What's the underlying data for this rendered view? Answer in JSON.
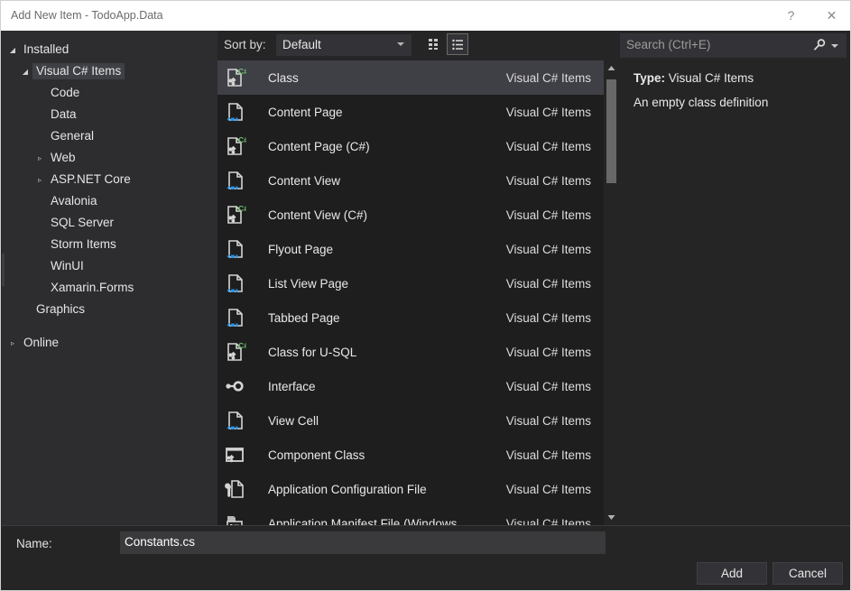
{
  "window": {
    "title": "Add New Item - TodoApp.Data",
    "help_label": "?",
    "close_label": "✕"
  },
  "sidebar": {
    "nodes": [
      {
        "label": "Installed",
        "level": 0,
        "twisty": "expanded",
        "selected": false
      },
      {
        "label": "Visual C# Items",
        "level": 1,
        "twisty": "expanded",
        "selected": true
      },
      {
        "label": "Code",
        "level": 2,
        "twisty": "none",
        "selected": false
      },
      {
        "label": "Data",
        "level": 2,
        "twisty": "none",
        "selected": false
      },
      {
        "label": "General",
        "level": 2,
        "twisty": "none",
        "selected": false
      },
      {
        "label": "Web",
        "level": 2,
        "twisty": "collapsed",
        "selected": false
      },
      {
        "label": "ASP.NET Core",
        "level": 2,
        "twisty": "collapsed",
        "selected": false
      },
      {
        "label": "Avalonia",
        "level": 2,
        "twisty": "none",
        "selected": false
      },
      {
        "label": "SQL Server",
        "level": 2,
        "twisty": "none",
        "selected": false
      },
      {
        "label": "Storm Items",
        "level": 2,
        "twisty": "none",
        "selected": false
      },
      {
        "label": "WinUI",
        "level": 2,
        "twisty": "none",
        "selected": false
      },
      {
        "label": "Xamarin.Forms",
        "level": 2,
        "twisty": "none",
        "selected": false
      },
      {
        "label": "Graphics",
        "level": 1,
        "twisty": "none",
        "selected": false
      },
      {
        "label": "Online",
        "level": 0,
        "twisty": "collapsed",
        "selected": false
      }
    ]
  },
  "toolbar": {
    "sort_by_label": "Sort by:",
    "sort_by_value": "Default",
    "tiles_view_icon": "tiles-view-icon",
    "list_view_icon": "list-view-icon"
  },
  "search": {
    "placeholder": "Search (Ctrl+E)",
    "icon": "search-icon"
  },
  "templates": {
    "items": [
      {
        "name": "Class",
        "category": "Visual C# Items",
        "icon": "csharp-class-icon",
        "selected": true
      },
      {
        "name": "Content Page",
        "category": "Visual C# Items",
        "icon": "xaml-page-icon",
        "selected": false
      },
      {
        "name": "Content Page (C#)",
        "category": "Visual C# Items",
        "icon": "csharp-class-icon",
        "selected": false
      },
      {
        "name": "Content View",
        "category": "Visual C# Items",
        "icon": "xaml-page-icon",
        "selected": false
      },
      {
        "name": "Content View (C#)",
        "category": "Visual C# Items",
        "icon": "csharp-class-icon",
        "selected": false
      },
      {
        "name": "Flyout Page",
        "category": "Visual C# Items",
        "icon": "xaml-page-icon",
        "selected": false
      },
      {
        "name": "List View Page",
        "category": "Visual C# Items",
        "icon": "xaml-page-icon",
        "selected": false
      },
      {
        "name": "Tabbed Page",
        "category": "Visual C# Items",
        "icon": "xaml-page-icon",
        "selected": false
      },
      {
        "name": "Class for U-SQL",
        "category": "Visual C# Items",
        "icon": "csharp-class-icon",
        "selected": false
      },
      {
        "name": "Interface",
        "category": "Visual C# Items",
        "icon": "interface-icon",
        "selected": false
      },
      {
        "name": "View Cell",
        "category": "Visual C# Items",
        "icon": "xaml-page-icon",
        "selected": false
      },
      {
        "name": "Component Class",
        "category": "Visual C# Items",
        "icon": "component-class-icon",
        "selected": false
      },
      {
        "name": "Application Configuration File",
        "category": "Visual C# Items",
        "icon": "config-file-icon",
        "selected": false
      },
      {
        "name": "Application Manifest File (Windows",
        "category": "Visual C# Items",
        "icon": "manifest-file-icon",
        "selected": false
      }
    ]
  },
  "details": {
    "type_label": "Type:",
    "type_value": "Visual C# Items",
    "description": "An empty class definition"
  },
  "footer": {
    "name_label": "Name:",
    "name_value": "Constants.cs",
    "add_label": "Add",
    "cancel_label": "Cancel"
  },
  "colors": {
    "dialog_bg": "#252526",
    "panel_bg": "#2d2d30",
    "list_bg": "#1e1e1e",
    "selection": "#3f3f46",
    "titlebar_bg": "#ffffff",
    "text": "#e9e9e9",
    "csharp_badge": "#6ec06e",
    "xaml_accent": "#2196f3"
  }
}
